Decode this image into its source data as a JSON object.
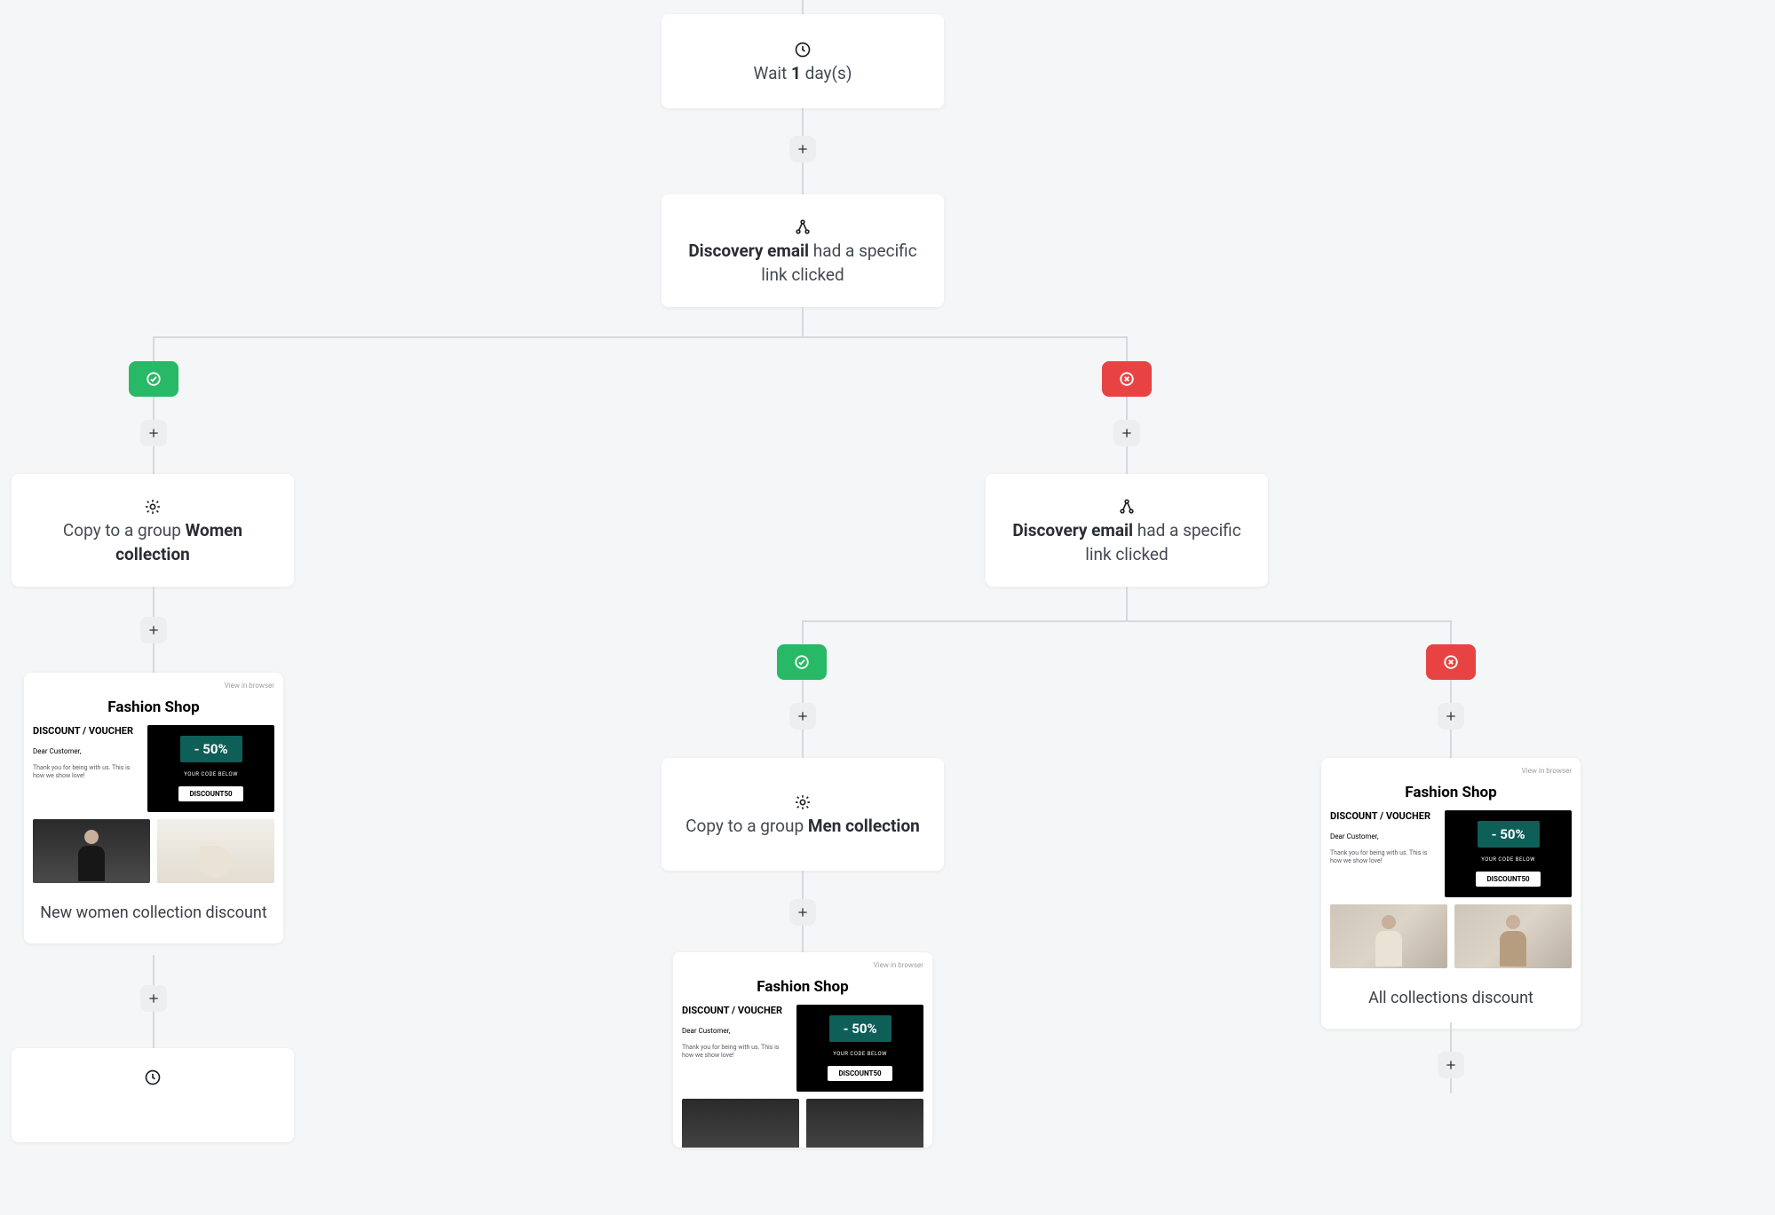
{
  "nodes": {
    "wait": {
      "prefix": "Wait ",
      "bold": "1",
      "suffix": " day(s)"
    },
    "discovery1": {
      "bold": "Discovery email",
      "suffix": " had a specific link clicked"
    },
    "copyWomen": {
      "prefix": "Copy to a group ",
      "bold": "Women collection"
    },
    "discovery2": {
      "bold": "Discovery email",
      "suffix": " had a specific link clicked"
    },
    "copyMen": {
      "prefix": "Copy to a group ",
      "bold": "Men collection"
    },
    "emailWomen": {
      "caption": "New women collection discount"
    },
    "emailAll": {
      "caption": "All collections discount"
    }
  },
  "emailPreview": {
    "browserLink": "View in browser",
    "brand": "Fashion Shop",
    "discountTitle": "DISCOUNT / VOUCHER",
    "dear": "Dear Customer,",
    "note": "Thank you for being with us. This is how we show love!",
    "pct": "- 50%",
    "yourCode": "YOUR CODE BELOW",
    "codeBtn": "DISCOUNT50"
  }
}
